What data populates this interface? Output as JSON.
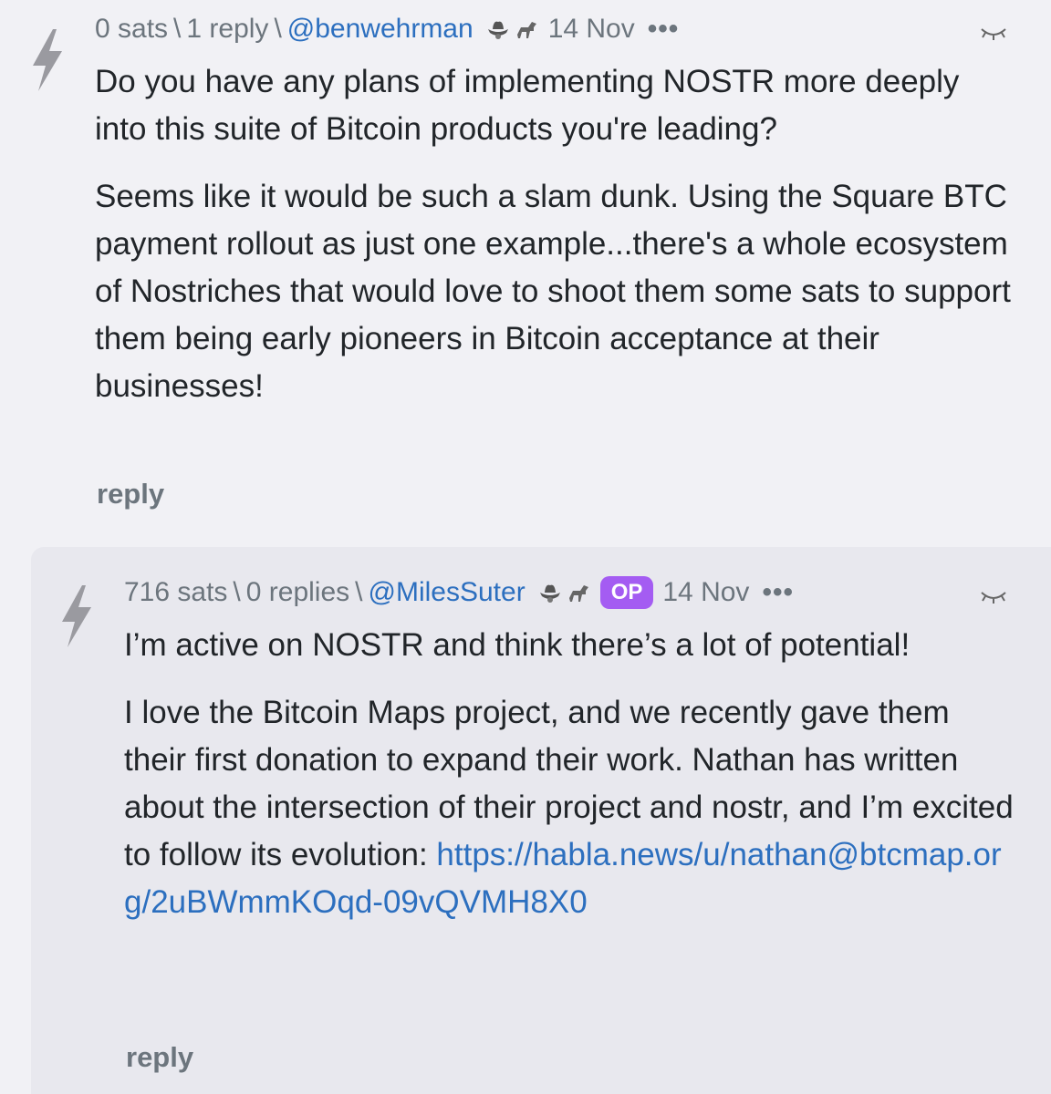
{
  "comments": [
    {
      "sats": "0 sats",
      "replies": "1 reply",
      "author": "@benwehrman",
      "date": "14 Nov",
      "more": "•••",
      "op_badge": "",
      "paragraphs": [
        "Do you have any plans of implementing NOSTR more deeply into this suite of Bitcoin products you're leading?",
        "Seems like it would be such a slam dunk. Using the Square BTC payment rollout as just one example...there's a whole ecosystem of Nostriches that would love to shoot them some sats to support them being early pioneers in Bitcoin acceptance at their businesses!"
      ],
      "reply_label": "reply"
    },
    {
      "sats": "716 sats",
      "replies": "0 replies",
      "author": "@MilesSuter",
      "date": "14 Nov",
      "more": "•••",
      "op_badge": "OP",
      "paragraphs": [
        "I’m active on NOSTR and think there’s a lot of potential!",
        "I love the Bitcoin Maps project, and we recently gave them their first donation to expand their work. Nathan has written about the intersection of their project and nostr, and I’m excited to follow its evolution:"
      ],
      "link": "https://habla.news/u/nathan@btcmap.org/2uBWmmKOqd-09vQVMH8X0",
      "reply_label": "reply"
    }
  ],
  "separator": "\\",
  "icons": {
    "zap": "lightning-bolt-icon",
    "hat": "cowboy-hat-icon",
    "horse": "horse-icon",
    "collapse": "eye-closed-icon"
  },
  "colors": {
    "background": "#f1f1f5",
    "nested_background": "#e8e8ee",
    "muted_text": "#6c757d",
    "link": "#2c6fbf",
    "op_badge": "#a45cf2"
  }
}
